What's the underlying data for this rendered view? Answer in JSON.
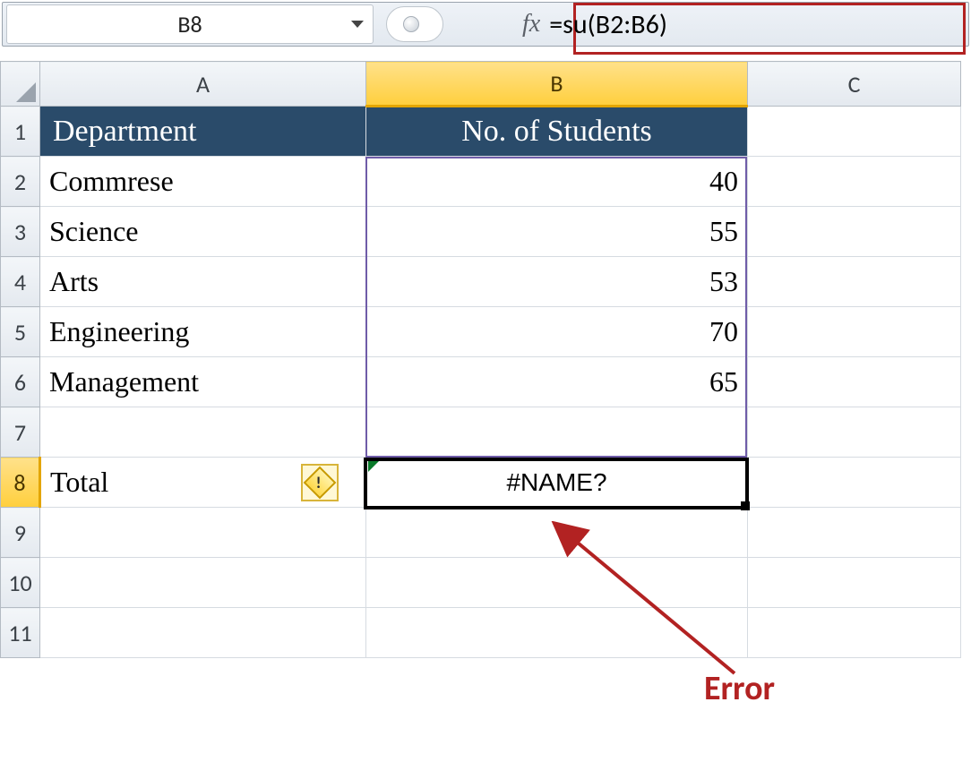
{
  "formula_bar": {
    "cell_ref": "B8",
    "fx_label": "fx",
    "formula": "=su(B2:B6)"
  },
  "columns": [
    "A",
    "B",
    "C"
  ],
  "row_numbers": [
    "1",
    "2",
    "3",
    "4",
    "5",
    "6",
    "7",
    "8",
    "9",
    "10",
    "11"
  ],
  "header_row": {
    "A": "Department",
    "B": "No. of Students"
  },
  "data_rows": [
    {
      "A": "Commrese",
      "B": "40"
    },
    {
      "A": "Science",
      "B": "55"
    },
    {
      "A": "Arts",
      "B": "53"
    },
    {
      "A": "Engineering",
      "B": "70"
    },
    {
      "A": "Management",
      "B": "65"
    }
  ],
  "row7": {
    "A": "",
    "B": ""
  },
  "row8": {
    "A": "Total",
    "B": "#NAME?"
  },
  "highlighted_range": "B2:B7",
  "selected_cell": "B8",
  "annotation": {
    "label": "Error"
  },
  "colors": {
    "header_bg": "#2A4B6A",
    "accent": "#B22222",
    "sel_gold": "#ffcf3d"
  }
}
